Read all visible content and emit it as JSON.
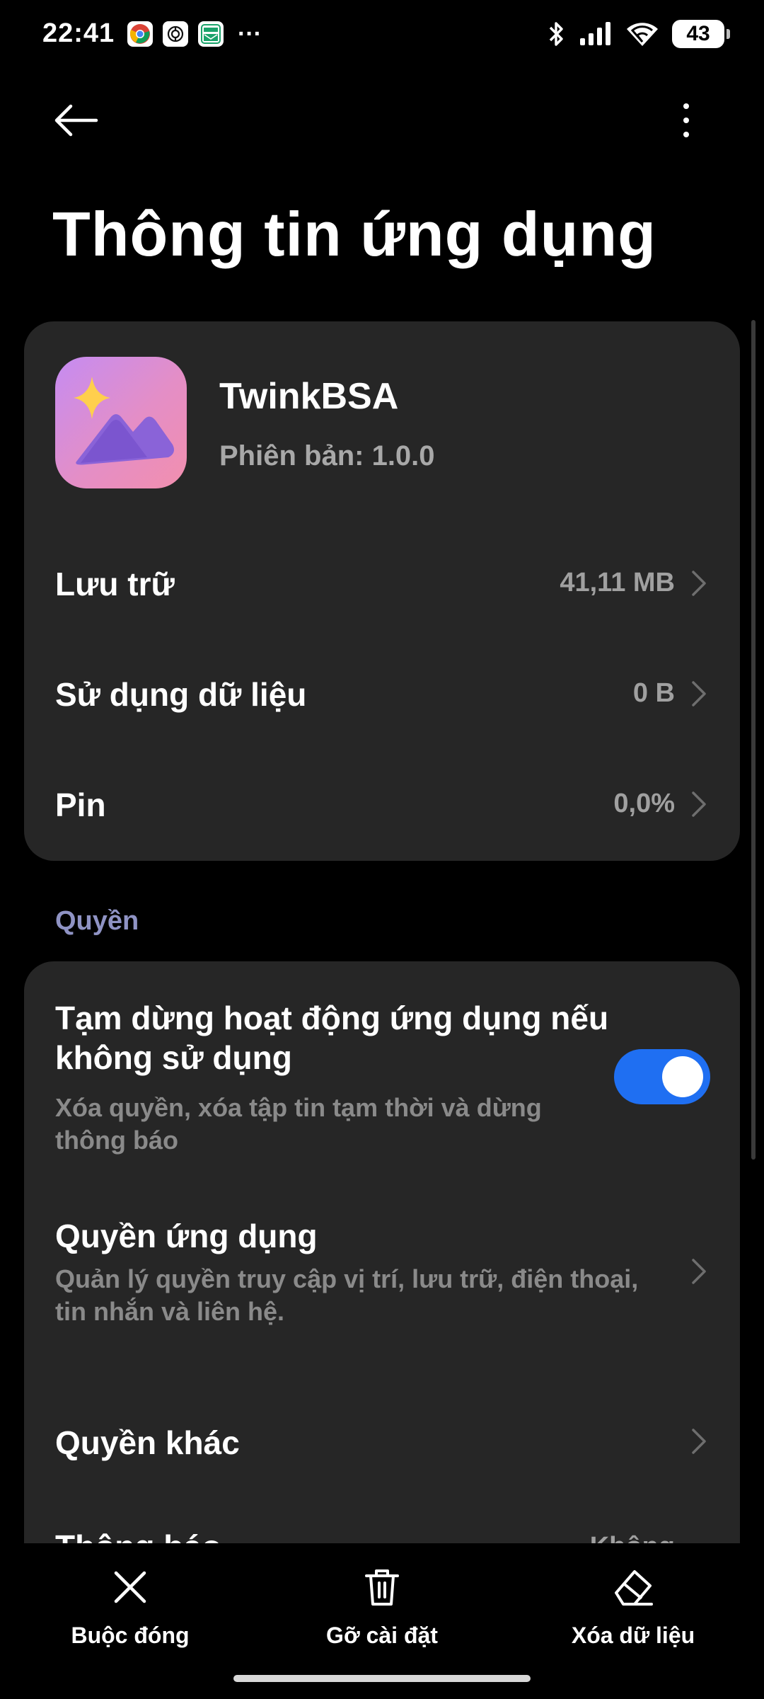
{
  "status_bar": {
    "time": "22:41",
    "notification_icons": [
      "chrome-icon",
      "chatgpt-icon",
      "temp-mail-icon"
    ],
    "more_notifications": "···",
    "battery": "43"
  },
  "header": {
    "title": "Thông tin ứng dụng"
  },
  "app": {
    "name": "TwinkBSA",
    "version": "Phiên bản: 1.0.0",
    "icon": "mountain-sparkle-icon"
  },
  "info_rows": [
    {
      "label": "Lưu trữ",
      "value": "41,11 MB"
    },
    {
      "label": "Sử dụng dữ liệu",
      "value": "0 B"
    },
    {
      "label": "Pin",
      "value": "0,0%"
    }
  ],
  "permissions": {
    "section_label": "Quyền",
    "pause_app": {
      "title": "Tạm dừng hoạt động ứng dụng nếu không sử dụng",
      "description": "Xóa quyền, xóa tập tin tạm thời và dừng thông báo",
      "enabled": true
    },
    "app_permissions": {
      "title": "Quyền ứng dụng",
      "description": "Quản lý quyền truy cập vị trí, lưu trữ, điện thoại, tin nhắn và liên hệ."
    },
    "other_permissions": {
      "title": "Quyền khác"
    },
    "partial_row": {
      "title": "Thông báo",
      "value": "Không"
    }
  },
  "bottom_actions": {
    "force_stop": "Buộc đóng",
    "uninstall": "Gỡ cài đặt",
    "clear_data": "Xóa dữ liệu"
  },
  "colors": {
    "background": "#000000",
    "card": "#262626",
    "accent": "#1f6ff2",
    "section_label": "#8f93c4",
    "secondary_text": "#a0a0a0"
  }
}
